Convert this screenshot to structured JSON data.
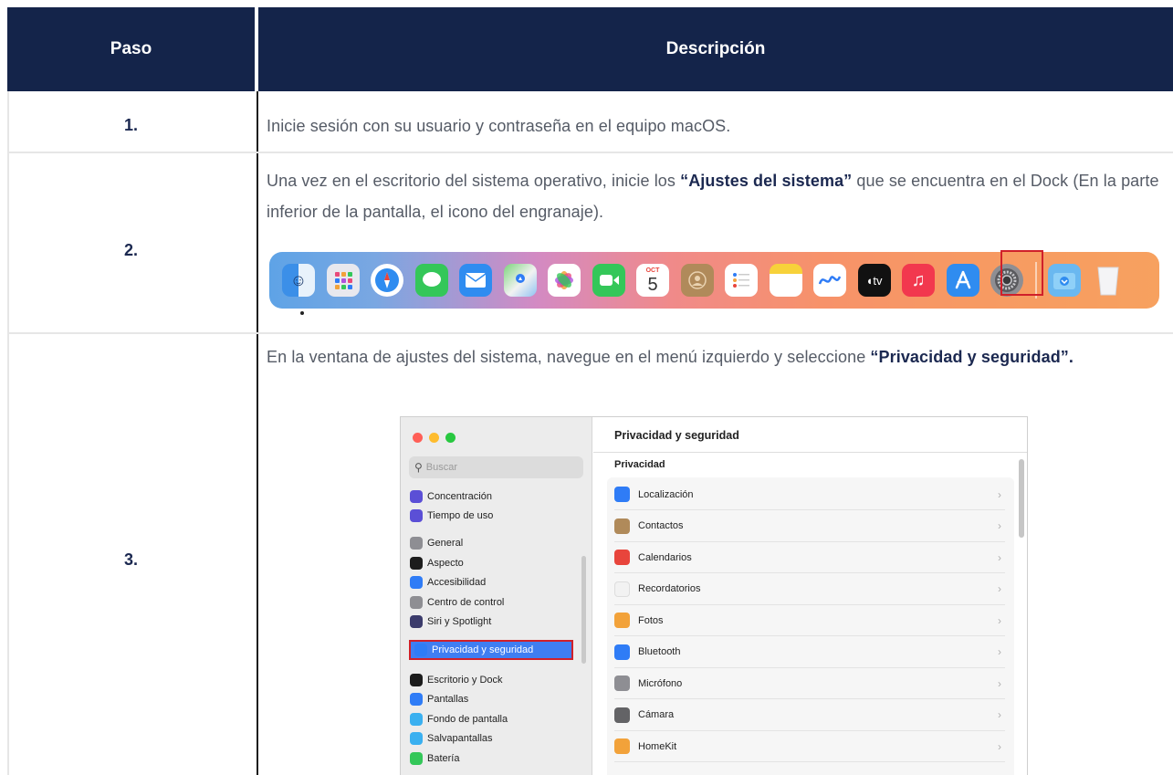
{
  "table": {
    "header": {
      "step": "Paso",
      "description": "Descripción"
    },
    "rows": [
      {
        "step": "1.",
        "text": "Inicie sesión con su usuario y contraseña en el equipo macOS."
      },
      {
        "step": "2.",
        "text_before": "Una vez en el escritorio del sistema operativo, inicie los ",
        "text_bold": "“Ajustes del sistema”",
        "text_after": " que se encuentra en el Dock (En la parte inferior de la pantalla, el icono del engranaje)."
      },
      {
        "step": "3.",
        "text_before": "En la ventana de ajustes del sistema, navegue en el menú izquierdo y seleccione ",
        "text_bold": "“Privacidad y seguridad”."
      }
    ]
  },
  "dock": {
    "calendar_month": "OCT",
    "calendar_day": "5",
    "tv_label": "tv",
    "icons": [
      "finder-icon",
      "launchpad-icon",
      "safari-icon",
      "messages-icon",
      "mail-icon",
      "maps-icon",
      "photos-icon",
      "facetime-icon",
      "calendar-icon",
      "contacts-icon",
      "reminders-icon",
      "notes-icon",
      "freeform-icon",
      "apple-tv-icon",
      "music-icon",
      "app-store-icon",
      "system-settings-icon",
      "downloads-folder-icon",
      "trash-icon"
    ]
  },
  "settings_window": {
    "search_placeholder": "Buscar",
    "sidebar_items": [
      {
        "label": "Concentración",
        "color": "#5b4fd6"
      },
      {
        "label": "Tiempo de uso",
        "color": "#5b4fd6"
      },
      {
        "label": "General",
        "color": "#8e8e93"
      },
      {
        "label": "Aspecto",
        "color": "#1c1c1c"
      },
      {
        "label": "Accesibilidad",
        "color": "#2f7cf6"
      },
      {
        "label": "Centro de control",
        "color": "#8e8e93"
      },
      {
        "label": "Siri y Spotlight",
        "color": "#3b3b6b"
      },
      {
        "label": "Privacidad y seguridad",
        "color": "#2f7cf6"
      },
      {
        "label": "Escritorio y Dock",
        "color": "#1c1c1c"
      },
      {
        "label": "Pantallas",
        "color": "#2f7cf6"
      },
      {
        "label": "Fondo de pantalla",
        "color": "#3ab0f0"
      },
      {
        "label": "Salvapantallas",
        "color": "#3ab0f0"
      },
      {
        "label": "Batería",
        "color": "#34c759"
      }
    ],
    "main_title": "Privacidad y seguridad",
    "section_title": "Privacidad",
    "items": [
      {
        "label": "Localización",
        "color": "#2f7cf6"
      },
      {
        "label": "Contactos",
        "color": "#b08a5a"
      },
      {
        "label": "Calendarios",
        "color": "#e8453c"
      },
      {
        "label": "Recordatorios",
        "color": "#f2f2f2"
      },
      {
        "label": "Fotos",
        "color": "#f2a23a"
      },
      {
        "label": "Bluetooth",
        "color": "#2f7cf6"
      },
      {
        "label": "Micrófono",
        "color": "#8e8e93"
      },
      {
        "label": "Cámara",
        "color": "#636366"
      },
      {
        "label": "HomeKit",
        "color": "#f2a23a"
      }
    ],
    "chevron": "›"
  }
}
